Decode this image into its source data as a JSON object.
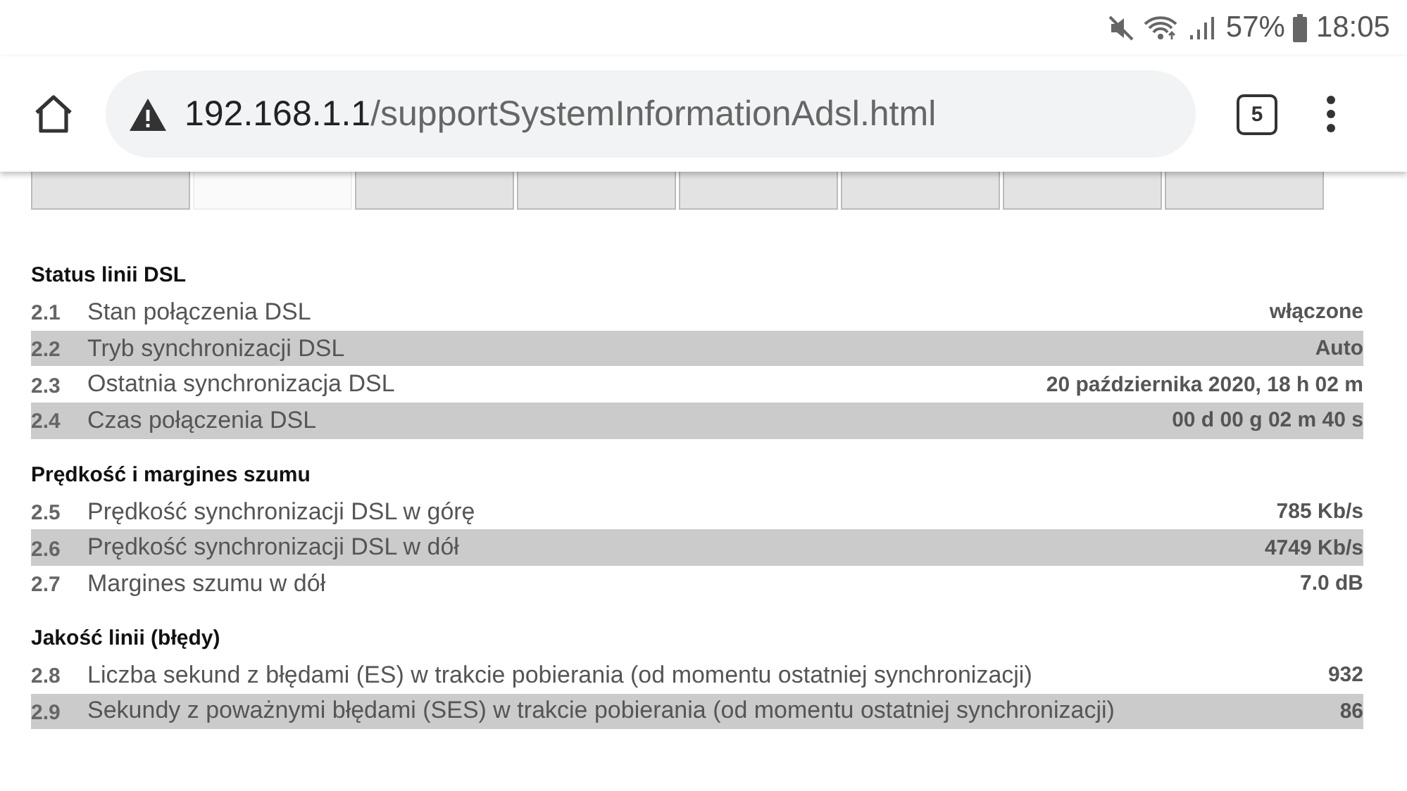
{
  "status_bar": {
    "battery": "57%",
    "time": "18:05"
  },
  "browser": {
    "url_host": "192.168.1.1",
    "url_path": "/supportSystemInformationAdsl.html",
    "tab_count": "5"
  },
  "tabs": [
    {
      "selected": false
    },
    {
      "selected": true
    },
    {
      "selected": false
    },
    {
      "selected": false
    },
    {
      "selected": false
    },
    {
      "selected": false
    },
    {
      "selected": false
    },
    {
      "selected": false
    }
  ],
  "sections": [
    {
      "title": "Status linii DSL",
      "rows": [
        {
          "number": "2.1",
          "label": "Stan połączenia DSL",
          "value": "włączone"
        },
        {
          "number": "2.2",
          "label": "Tryb synchronizacji DSL",
          "value": "Auto"
        },
        {
          "number": "2.3",
          "label": "Ostatnia synchronizacja DSL",
          "value": "20 października 2020, 18 h 02 m"
        },
        {
          "number": "2.4",
          "label": "Czas połączenia DSL",
          "value": "00 d 00 g 02 m 40 s"
        }
      ]
    },
    {
      "title": "Prędkość i margines szumu",
      "rows": [
        {
          "number": "2.5",
          "label": "Prędkość synchronizacji DSL w górę",
          "value": "785 Kb/s"
        },
        {
          "number": "2.6",
          "label": "Prędkość synchronizacji DSL w dół",
          "value": "4749 Kb/s"
        },
        {
          "number": "2.7",
          "label": "Margines szumu w dół",
          "value": "7.0 dB"
        }
      ]
    },
    {
      "title": "Jakość linii (błędy)",
      "rows": [
        {
          "number": "2.8",
          "label": "Liczba sekund z błędami (ES) w trakcie pobierania (od momentu ostatniej synchronizacji)",
          "value": "932"
        },
        {
          "number": "2.9",
          "label": "Sekundy z poważnymi błędami (SES) w trakcie pobierania (od momentu ostatniej synchronizacji)",
          "value": "86"
        }
      ]
    }
  ]
}
